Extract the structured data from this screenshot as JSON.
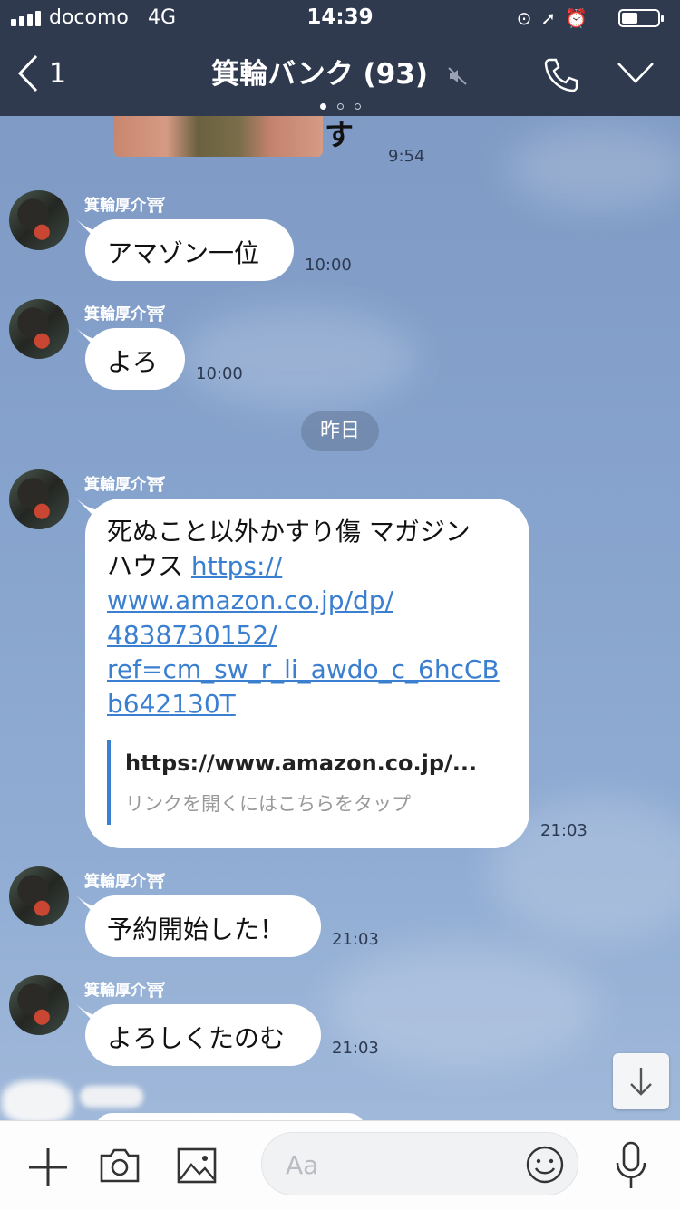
{
  "status_bar": {
    "carrier": "docomo",
    "network": "4G",
    "time": "14:39",
    "battery_level": 0.45,
    "icons": [
      "rotation-lock-icon",
      "location-arrow-icon",
      "alarm-icon"
    ]
  },
  "header": {
    "back_count": "1",
    "title": "箕輪バンク (93)",
    "icons": [
      "mute-icon",
      "phone-icon",
      "chevron-down-icon"
    ],
    "page_dots": 3,
    "active_dot": 0
  },
  "chat": {
    "top_image_caption": "す",
    "top_image_time": "9:54",
    "date_divider": "昨日",
    "messages": [
      {
        "sender": "箕輪厚介⛩",
        "text": "アマゾン一位",
        "time": "10:00"
      },
      {
        "sender": "箕輪厚介⛩",
        "text": "よろ",
        "time": "10:00"
      },
      {
        "sender": "箕輪厚介⛩",
        "text_lines": [
          "死ぬこと以外かすり傷 マガジン",
          "ハウス "
        ],
        "link_lines": [
          "https://",
          "www.amazon.co.jp/dp/",
          "4838730152/",
          "ref=cm_sw_r_li_awdo_c_6hcCB",
          "b642130T"
        ],
        "preview_title": "https://www.amazon.co.jp/...",
        "preview_subtitle": "リンクを開くにはこちらをタップ",
        "time": "21:03"
      },
      {
        "sender": "箕輪厚介⛩",
        "text": "予約開始した！",
        "time": "21:03"
      },
      {
        "sender": "箕輪厚介⛩",
        "text": "よろしくたのむ",
        "time": "21:03"
      }
    ]
  },
  "input_bar": {
    "placeholder": "Aa",
    "icons": [
      "plus-icon",
      "camera-icon",
      "image-icon",
      "emoji-icon",
      "microphone-icon"
    ]
  },
  "colors": {
    "header_bg": "#2f3a4f",
    "chat_bg": "#86a3cd",
    "link": "#3b7fd0"
  }
}
